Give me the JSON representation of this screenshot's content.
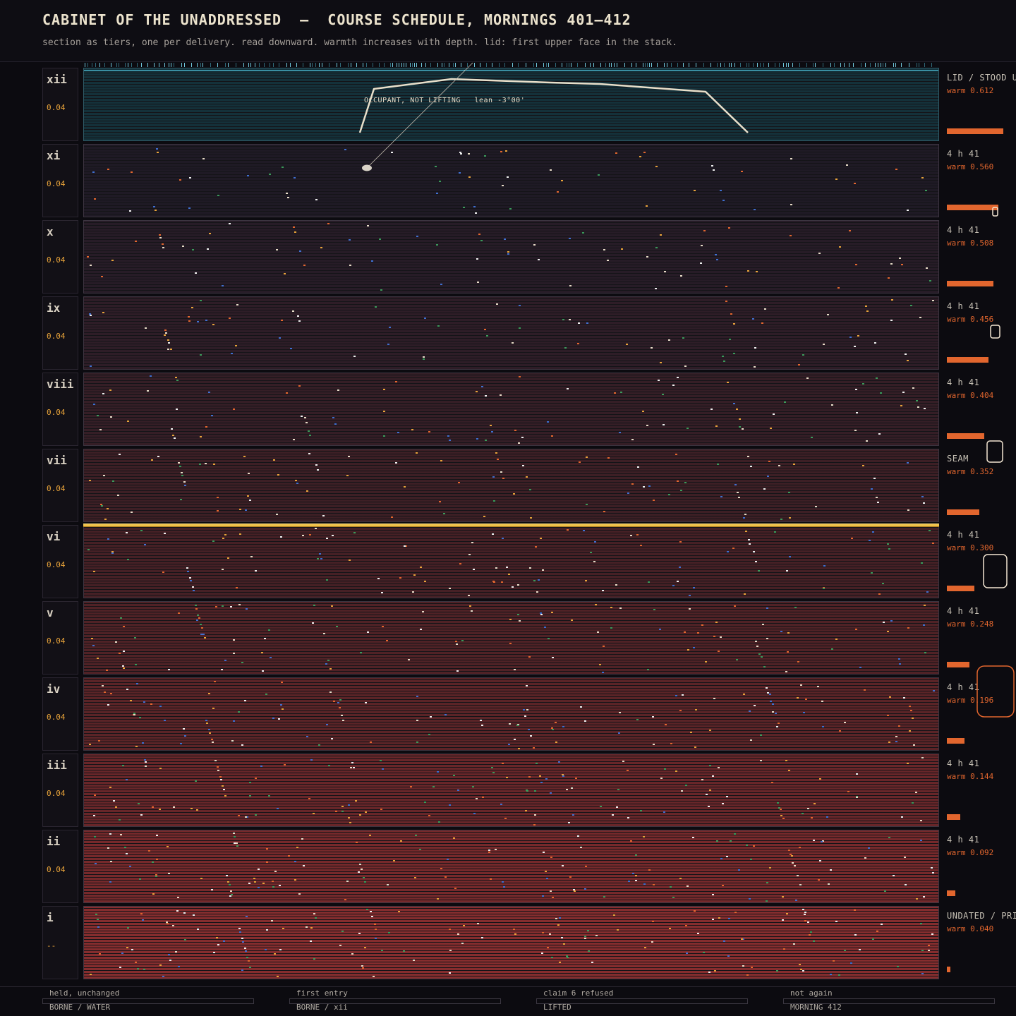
{
  "header": {
    "title": "CABINET OF THE UNADDRESSED  —  COURSE SCHEDULE, MORNINGS 401–412",
    "subtitle": "section as tiers, one per delivery. read downward. warmth increases with depth. lid: first upper face in the stack."
  },
  "lid_annotation": "OCCUPANT, NOT LIFTING   lean -3°00'",
  "colors": {
    "accent_warm": "#e2662e",
    "value_amber": "#e8a33a",
    "lid_cyan": "#4fd3ec",
    "seam_gold": "#f0c24a"
  },
  "tiers": [
    {
      "numeral": "xii",
      "value": "0.04",
      "status": "LID / STOOD UPRIGHT",
      "warm_label": "warm 0.612",
      "warmth": 0.612,
      "color": "#14313a"
    },
    {
      "numeral": "xi",
      "value": "0.04",
      "status": "4 h 41",
      "warm_label": "warm 0.560",
      "warmth": 0.56,
      "color": "#1f1a25"
    },
    {
      "numeral": "x",
      "value": "0.04",
      "status": "4 h 41",
      "warm_label": "warm 0.508",
      "warmth": 0.508,
      "color": "#271c27"
    },
    {
      "numeral": "ix",
      "value": "0.04",
      "status": "4 h 41",
      "warm_label": "warm 0.456",
      "warmth": 0.456,
      "color": "#2e1d27"
    },
    {
      "numeral": "viii",
      "value": "0.04",
      "status": "4 h 41",
      "warm_label": "warm 0.404",
      "warmth": 0.404,
      "color": "#351e26"
    },
    {
      "numeral": "vii",
      "value": "0.04",
      "status": "SEAM",
      "warm_label": "warm 0.352",
      "warmth": 0.352,
      "color": "#3d1f25"
    },
    {
      "numeral": "vi",
      "value": "0.04",
      "status": "4 h 41",
      "warm_label": "warm 0.300",
      "warmth": 0.3,
      "color": "#462025"
    },
    {
      "numeral": "v",
      "value": "0.04",
      "status": "4 h 41",
      "warm_label": "warm 0.248",
      "warmth": 0.248,
      "color": "#502226"
    },
    {
      "numeral": "iv",
      "value": "0.04",
      "status": "4 h 41",
      "warm_label": "warm 0.196",
      "warmth": 0.196,
      "color": "#5b2427"
    },
    {
      "numeral": "iii",
      "value": "0.04",
      "status": "4 h 41",
      "warm_label": "warm 0.144",
      "warmth": 0.144,
      "color": "#682629"
    },
    {
      "numeral": "ii",
      "value": "0.04",
      "status": "4 h 41",
      "warm_label": "warm 0.092",
      "warmth": 0.092,
      "color": "#76292b"
    },
    {
      "numeral": "i",
      "value": "--",
      "status": "UNDATED / PRIOR",
      "warm_label": "warm 0.040",
      "warmth": 0.04,
      "color": "#852d2e"
    }
  ],
  "footer": [
    {
      "top": "held, unchanged",
      "bottom": "BORNE / WATER"
    },
    {
      "top": "first entry",
      "bottom": "BORNE / xii"
    },
    {
      "top": "claim 6 refused",
      "bottom": "LIFTED"
    },
    {
      "top": "not again",
      "bottom": "MORNING 412"
    }
  ]
}
